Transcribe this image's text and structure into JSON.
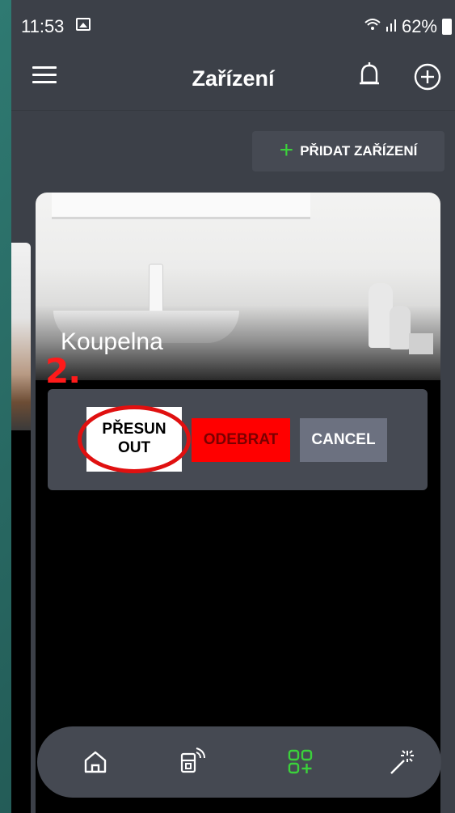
{
  "status_bar": {
    "time": "11:53",
    "battery": "62%"
  },
  "app_bar": {
    "title": "Zařízení"
  },
  "add_device_button": {
    "label": "PŘIDAT ZAŘÍZENÍ"
  },
  "room_card": {
    "name": "Koupelna"
  },
  "annotation": {
    "step": "2."
  },
  "actions": {
    "move_label_line1": "PŘESUN",
    "move_label_line2": "OUT",
    "remove_label": "ODEBRAT",
    "cancel_label": "CANCEL"
  },
  "colors": {
    "accent_green": "#3bd13b",
    "remove_red": "#ff0000",
    "highlight_red": "#e01010",
    "cancel_gray": "#6c7180"
  },
  "bottom_nav": {
    "items": [
      "home-icon",
      "devices-icon",
      "grid-add-icon",
      "magic-wand-icon"
    ],
    "active": "grid-add-icon"
  }
}
